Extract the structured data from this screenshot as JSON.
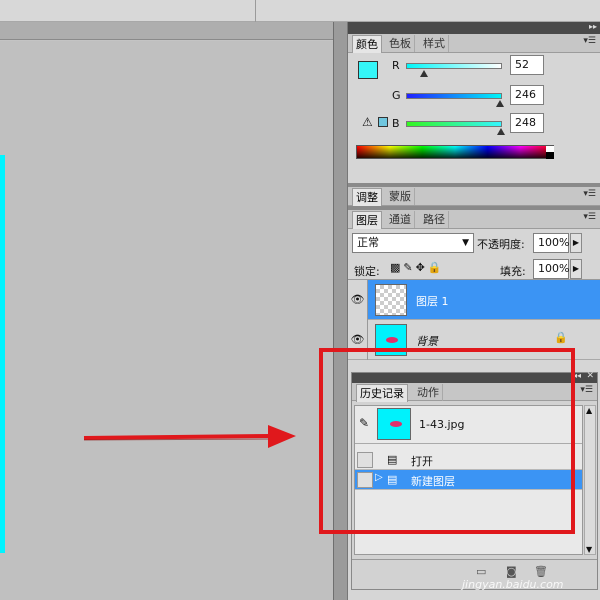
{
  "color_panel": {
    "tabs": [
      "颜色",
      "色板",
      "样式"
    ],
    "r_label": "R",
    "g_label": "G",
    "b_label": "B",
    "r_value": "52",
    "g_value": "246",
    "b_value": "248",
    "foreground_color": "#34f6f8",
    "background_color": "#f07ef0"
  },
  "adjust_panel": {
    "tabs": [
      "调整",
      "蒙版"
    ]
  },
  "layers_panel": {
    "tabs": [
      "图层",
      "通道",
      "路径"
    ],
    "blend_mode": "正常",
    "opacity_label": "不透明度:",
    "opacity_value": "100%",
    "lock_label": "锁定:",
    "fill_label": "填充:",
    "fill_value": "100%",
    "layers": [
      {
        "name": "图层 1",
        "selected": true
      },
      {
        "name": "背景",
        "selected": false
      }
    ]
  },
  "history_panel": {
    "tabs": [
      "历史记录",
      "动作"
    ],
    "snapshot_name": "1-43.jpg",
    "items": [
      "打开",
      "新建图层"
    ]
  },
  "watermark": "jingyan.baidu.com",
  "colors": {
    "selection": "#3b94f4",
    "highlight_box": "#e0181c",
    "canvas_edge": "#00f4ff"
  }
}
